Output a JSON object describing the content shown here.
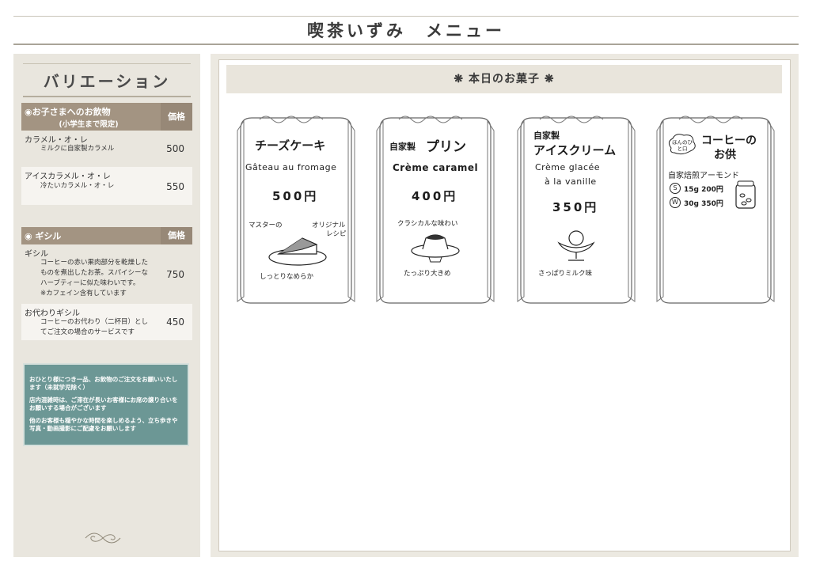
{
  "page": {
    "title": "喫茶いずみ　メニュー"
  },
  "sidebar": {
    "heading": "バリエーション",
    "kids": {
      "title": "◉お子さまへのお飲物",
      "subtitle": "(小学生まで限定)",
      "price_header": "価格",
      "items": [
        {
          "name": "カラメル・オ・レ",
          "desc": "ミルクに自家製カラメル",
          "price": "500"
        },
        {
          "name": "アイスカラメル・オ・レ",
          "desc": "冷たいカラメル・オ・レ",
          "price": "550"
        }
      ]
    },
    "gisiru": {
      "title": "◉ ギシル",
      "price_header": "価格",
      "items": [
        {
          "name": "ギシル",
          "desc": "コーヒーの赤い果肉部分を乾燥した\nものを煮出したお茶。スパイシーな\nハーブティーに似た味わいです。\n※カフェイン含有しています",
          "price": "750"
        },
        {
          "name": "お代わりギシル",
          "desc": "コーヒーのお代わり（二杯目）とし\nてご注文の場合のサービスです",
          "price": "450"
        }
      ]
    },
    "notice": [
      "おひとり様につき一品、お飲物のご注文をお願いいたします（未就学児除く）",
      "店内混雑時は、ご滞在が長いお客様にお席の譲り合いをお願いする場合がございます",
      "他のお客様も穏やかな時間を楽しめるよう、立ち歩きや写真・動画撮影にご配慮をお願いします"
    ],
    "flourish_icon": "ornament-flourish-icon"
  },
  "main": {
    "today_title": "❋ 本日のお菓子 ❋",
    "cards": [
      {
        "title": "チーズケーキ",
        "subtitle": "Gâteau au fromage",
        "price": "500円",
        "note1": "マスターの",
        "note2": "オリジナル",
        "note3": "レシピ",
        "note4": "しっとりなめらか",
        "icon": "cheesecake-icon"
      },
      {
        "title_prefix": "自家製",
        "title": "プリン",
        "subtitle": "Crème caramel",
        "price": "400円",
        "note1": "クラシカルな味わい",
        "note2": "たっぷり大きめ",
        "icon": "pudding-icon"
      },
      {
        "title_prefix": "自家製",
        "title": "アイスクリーム",
        "subtitle": "Crème glacée",
        "subtitle2": "à la vanille",
        "price": "350円",
        "note1": "さっぱりミルク味",
        "icon": "ice-cream-icon"
      },
      {
        "bubble": "ほんのひと口",
        "title": "コーヒーの",
        "title2": "お供",
        "line1": "自家焙煎アーモンド",
        "opt1_badge": "S",
        "opt1": "15g 200円",
        "opt2_badge": "W",
        "opt2": "30g 350円",
        "icon": "almond-jar-icon"
      }
    ]
  }
}
